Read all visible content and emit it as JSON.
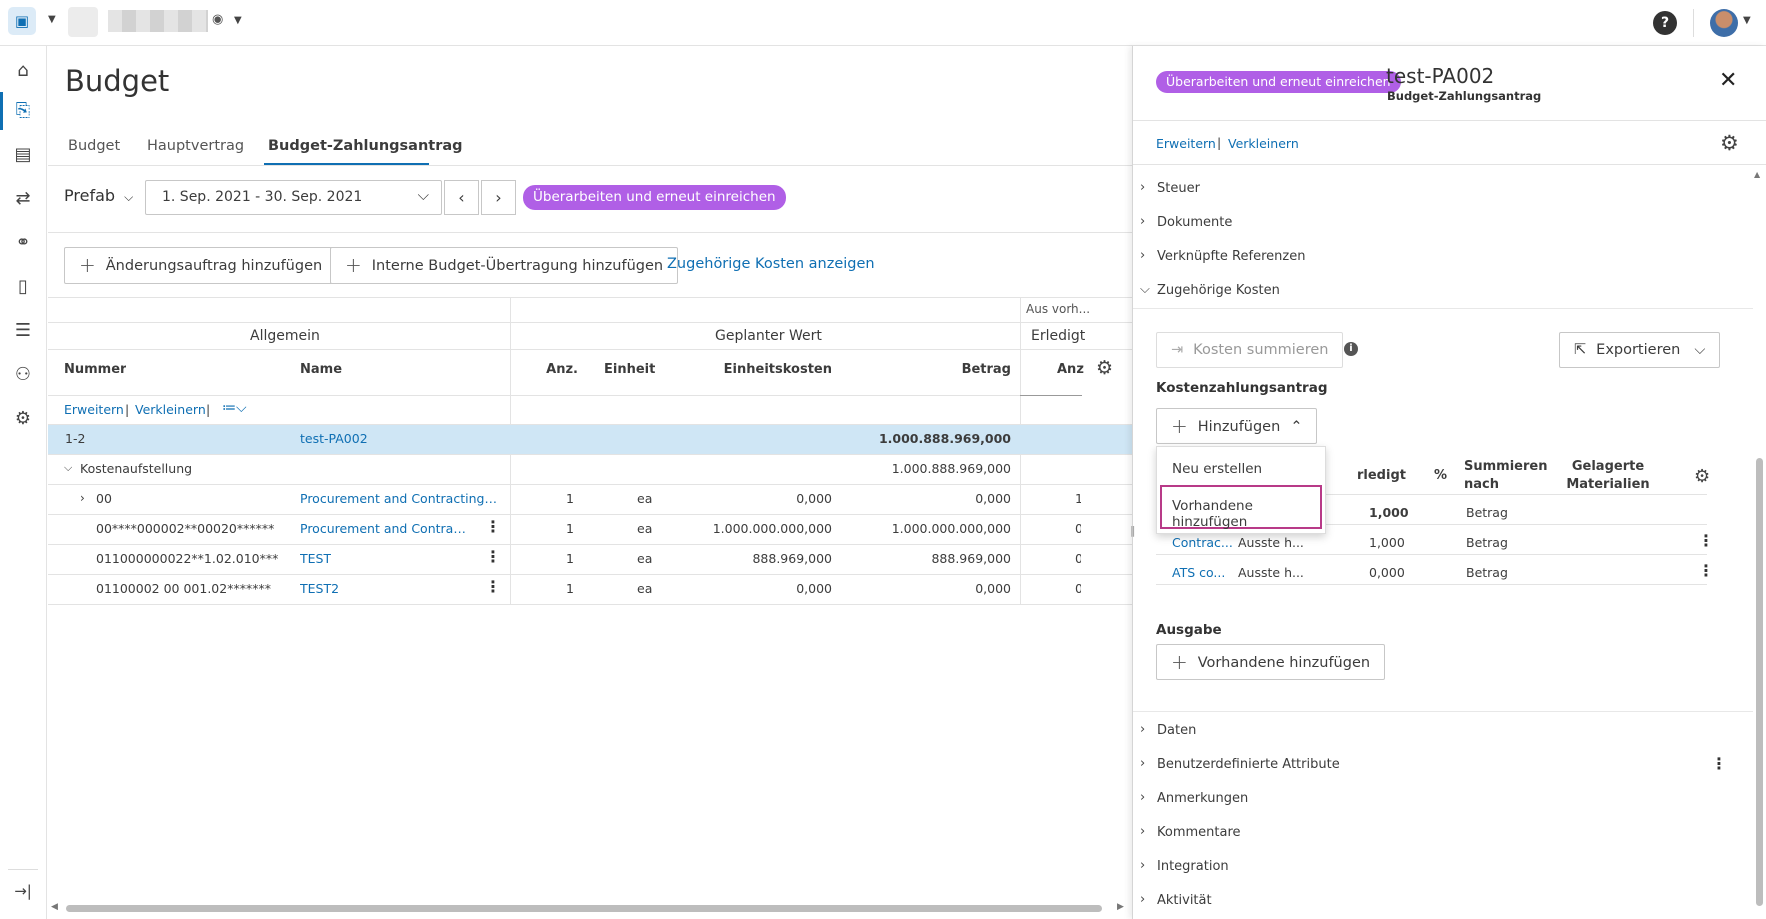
{
  "topbar": {
    "app_icon": "project-switcher-icon",
    "help_label": "?",
    "avatar": "user-avatar"
  },
  "leftnav": {
    "items": [
      "home-icon",
      "budget-icon",
      "cost-icon",
      "change-icon",
      "binoculars-icon",
      "document-icon",
      "report-icon",
      "members-icon",
      "settings-icon"
    ],
    "collapse_icon": "collapse-icon"
  },
  "page": {
    "title": "Budget",
    "tabs": [
      "Budget",
      "Hauptvertrag",
      "Budget-Zahlungsantrag"
    ],
    "active_tab": 2,
    "filter": {
      "company": "Prefab",
      "period": "1. Sep. 2021 - 30. Sep. 2021",
      "status_badge": "Überarbeiten und erneut einreichen"
    },
    "actions": {
      "add_change_order": "Änderungsauftrag hinzufügen",
      "add_internal_transfer": "Interne Budget-Übertragung hinzufügen",
      "show_related_costs": "Zugehörige Kosten anzeigen"
    }
  },
  "table": {
    "group_headers": {
      "general": "Allgemein",
      "planned": "Geplanter Wert",
      "prev": "Aus vorh...",
      "done": "Erledigt"
    },
    "columns": [
      "Nummer",
      "Name",
      "Anz.",
      "Einheit",
      "Einheitskosten",
      "Betrag",
      "Anz"
    ],
    "expand_label": "Erweitern",
    "collapse_label": "Verkleinern",
    "rows": [
      {
        "nummer": "1-2",
        "name": "test-PA002",
        "anz": "",
        "einheit": "",
        "einheitskosten": "",
        "betrag": "1.000.888.969,000",
        "anz2": ""
      },
      {
        "nummer": "Kostenaufstellung",
        "name": "",
        "anz": "",
        "einheit": "",
        "einheitskosten": "",
        "betrag": "1.000.888.969,000",
        "anz2": ""
      },
      {
        "nummer": "00",
        "name": "Procurement and Contracting Req...",
        "anz": "1",
        "einheit": "ea",
        "einheitskosten": "0,000",
        "betrag": "0,000",
        "anz2": "1"
      },
      {
        "nummer": "00****000002**00020******",
        "name": "Procurement and Contractin...",
        "anz": "1",
        "einheit": "ea",
        "einheitskosten": "1.000.000.000,000",
        "betrag": "1.000.000.000,000",
        "anz2": "0"
      },
      {
        "nummer": "011000000022**1.02.010***",
        "name": "TEST",
        "anz": "1",
        "einheit": "ea",
        "einheitskosten": "888.969,000",
        "betrag": "888.969,000",
        "anz2": "0"
      },
      {
        "nummer": "01100002 00 001.02*******",
        "name": "TEST2",
        "anz": "1",
        "einheit": "ea",
        "einheitskosten": "0,000",
        "betrag": "0,000",
        "anz2": "0"
      }
    ]
  },
  "panel": {
    "status_badge": "Überarbeiten und erneut einreichen",
    "title": "test-PA002",
    "subtitle": "Budget-Zahlungsantrag",
    "expand_label": "Erweitern",
    "collapse_label": "Verkleinern",
    "sections_top": [
      "Steuer",
      "Dokumente",
      "Verknüpfte Referenzen",
      "Zugehörige Kosten"
    ],
    "sum_costs_button": "Kosten summieren",
    "export_button": "Exportieren",
    "cost_payment_title": "Kostenzahlungsantrag",
    "add_button": "Hinzufügen",
    "dropdown": {
      "items": [
        "Neu erstellen",
        "Vorhandene hinzufügen"
      ]
    },
    "cost_table": {
      "columns": [
        "rledigt",
        "%",
        "Summieren nach",
        "Gelagerte Materialien"
      ],
      "rows": [
        {
          "name": "",
          "status": "",
          "done": "1,000",
          "sum": "Betrag"
        },
        {
          "name": "Contrac...",
          "status": "Ausste h...",
          "done": "1,000",
          "sum": "Betrag"
        },
        {
          "name": "ATS co...",
          "status": "Ausste h...",
          "done": "0,000",
          "sum": "Betrag"
        }
      ]
    },
    "expense_title": "Ausgabe",
    "add_existing_button": "Vorhandene hinzufügen",
    "sections_bottom": [
      "Daten",
      "Benutzerdefinierte Attribute",
      "Anmerkungen",
      "Kommentare",
      "Integration",
      "Aktivität"
    ]
  }
}
